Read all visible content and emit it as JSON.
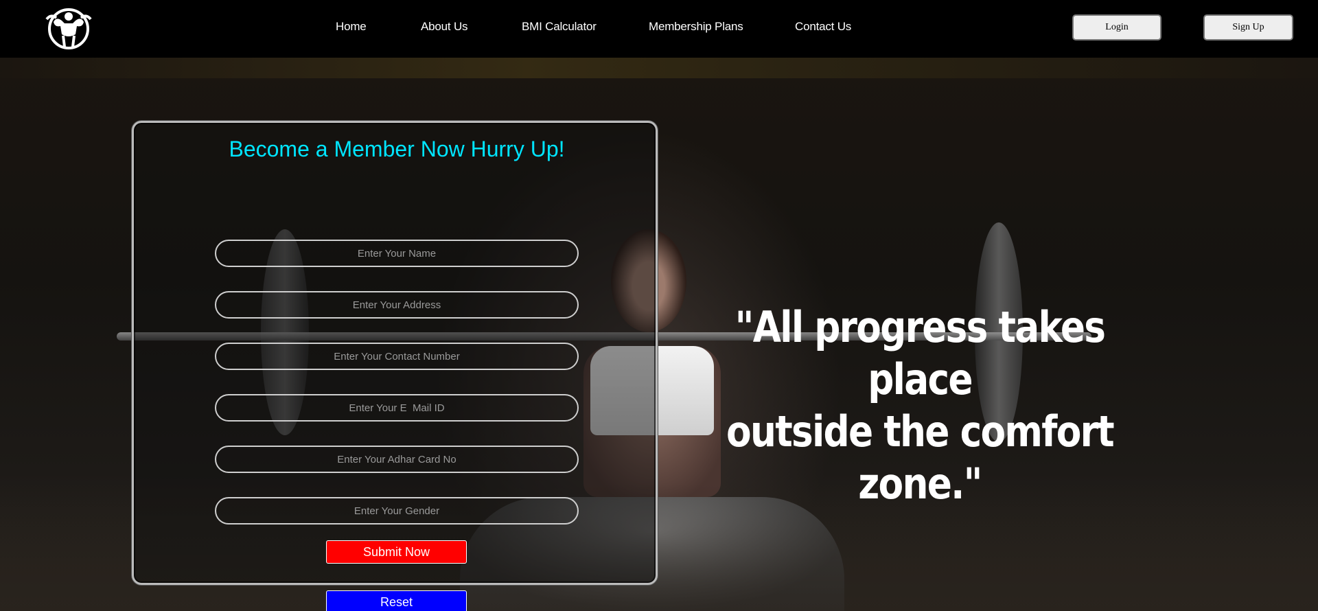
{
  "nav": {
    "logo_icon": "bodybuilder-logo-icon",
    "links": [
      "Home",
      "About Us",
      "BMI Calculator",
      "Membership Plans",
      "Contact Us"
    ],
    "login_label": "Login",
    "signup_label": "Sign Up"
  },
  "form": {
    "title": "Become a Member Now   Hurry Up!",
    "fields": [
      {
        "placeholder": "Enter Your Name",
        "value": ""
      },
      {
        "placeholder": "Enter Your Address",
        "value": ""
      },
      {
        "placeholder": "Enter Your Contact Number",
        "value": ""
      },
      {
        "placeholder": "Enter Your E  Mail ID",
        "value": ""
      },
      {
        "placeholder": "Enter Your Adhar Card No",
        "value": ""
      },
      {
        "placeholder": "Enter Your Gender",
        "value": ""
      }
    ],
    "submit_label": "Submit Now",
    "reset_label": "Reset"
  },
  "hero": {
    "quote_line1": "\"All progress takes place",
    "quote_line2": "outside the comfort zone.\""
  },
  "colors": {
    "title": "#00e5ff",
    "submit": "#ff0000",
    "reset": "#0000ff"
  }
}
